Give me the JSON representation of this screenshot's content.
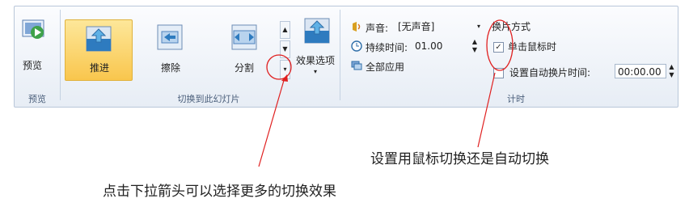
{
  "ribbon": {
    "preview_group": {
      "button_label": "预览",
      "group_label": "预览"
    },
    "transition_group": {
      "items": [
        {
          "label": "推进",
          "selected": true
        },
        {
          "label": "擦除",
          "selected": false
        },
        {
          "label": "分割",
          "selected": false
        }
      ],
      "effect_options_label": "效果选项",
      "group_label": "切换到此幻灯片"
    },
    "timing_group": {
      "sound_label": "声音:",
      "sound_value": "[无声音]",
      "duration_label": "持续时间:",
      "duration_value": "01.00",
      "apply_all_label": "全部应用",
      "advance_heading": "换片方式",
      "on_click_label": "单击鼠标时",
      "on_click_checked": true,
      "after_label": "设置自动换片时间:",
      "after_value": "00:00.00",
      "after_checked": false,
      "group_label": "计时"
    }
  },
  "annotations": {
    "callout_right": "设置用鼠标切换还是自动切换",
    "callout_left": "点击下拉箭头可以选择更多的切换效果"
  },
  "colors": {
    "selected_tile": "#f9c64d",
    "callout": "#e02020",
    "ribbon_border": "#b9c7d9"
  }
}
